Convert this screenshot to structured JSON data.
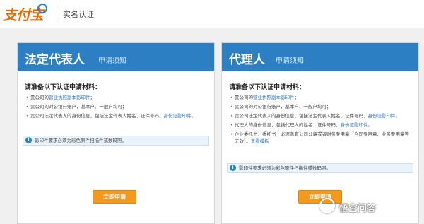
{
  "header": {
    "logo_text": "支付宝",
    "page_name": "实名认证"
  },
  "panels": {
    "left": {
      "title": "法定代表人",
      "subtitle": "申请须知",
      "req_title": "请准备以下认证申请材料：",
      "items": [
        {
          "prefix": "贵公司的",
          "link": "营业执照副本影印件",
          "suffix": "；"
        },
        {
          "prefix": "贵公司的对公银行账户，基本户、一般户均可；",
          "link": "",
          "suffix": ""
        },
        {
          "prefix": "贵公司法定代表人的身份信息，包括法定代表人姓名、证件号码、",
          "link": "身份证影印件",
          "suffix": "。"
        }
      ],
      "notice": "影印件要求必须为彩色原件扫描件或数码照。",
      "button": "立即申请"
    },
    "right": {
      "title": "代理人",
      "subtitle": "申请须知",
      "req_title": "请准备以下认证申请材料：",
      "items": [
        {
          "prefix": "贵公司的",
          "link": "营业执照副本影印件",
          "suffix": "；"
        },
        {
          "prefix": "贵公司的对公银行账户，基本户、一般户均可；",
          "link": "",
          "suffix": ""
        },
        {
          "prefix": "贵公司法定代表人的身份信息，包括法定代表人姓名、证件号码、",
          "link": "身份证影印件",
          "suffix": "。"
        },
        {
          "prefix": "代理人的身份信息，包括代理人的姓名、证件号码、",
          "link": "身份证影印件",
          "suffix": "。"
        },
        {
          "prefix": "企业委托书，委托书上必须盖有公司公章或者财务专用章（合同专用章、业务专用章等无效）。",
          "link": "查看模板",
          "suffix": ""
        }
      ],
      "notice": "影印件要求必须为彩色原件扫描件或数码照。",
      "button": "立即申请"
    }
  },
  "watermark": "悟空问答",
  "icons": {
    "info": "info-icon"
  },
  "colors": {
    "panel_header": "#2d7fc4",
    "button": "#f39a1e",
    "logo": "#e66a00",
    "link": "#2a74c0"
  }
}
